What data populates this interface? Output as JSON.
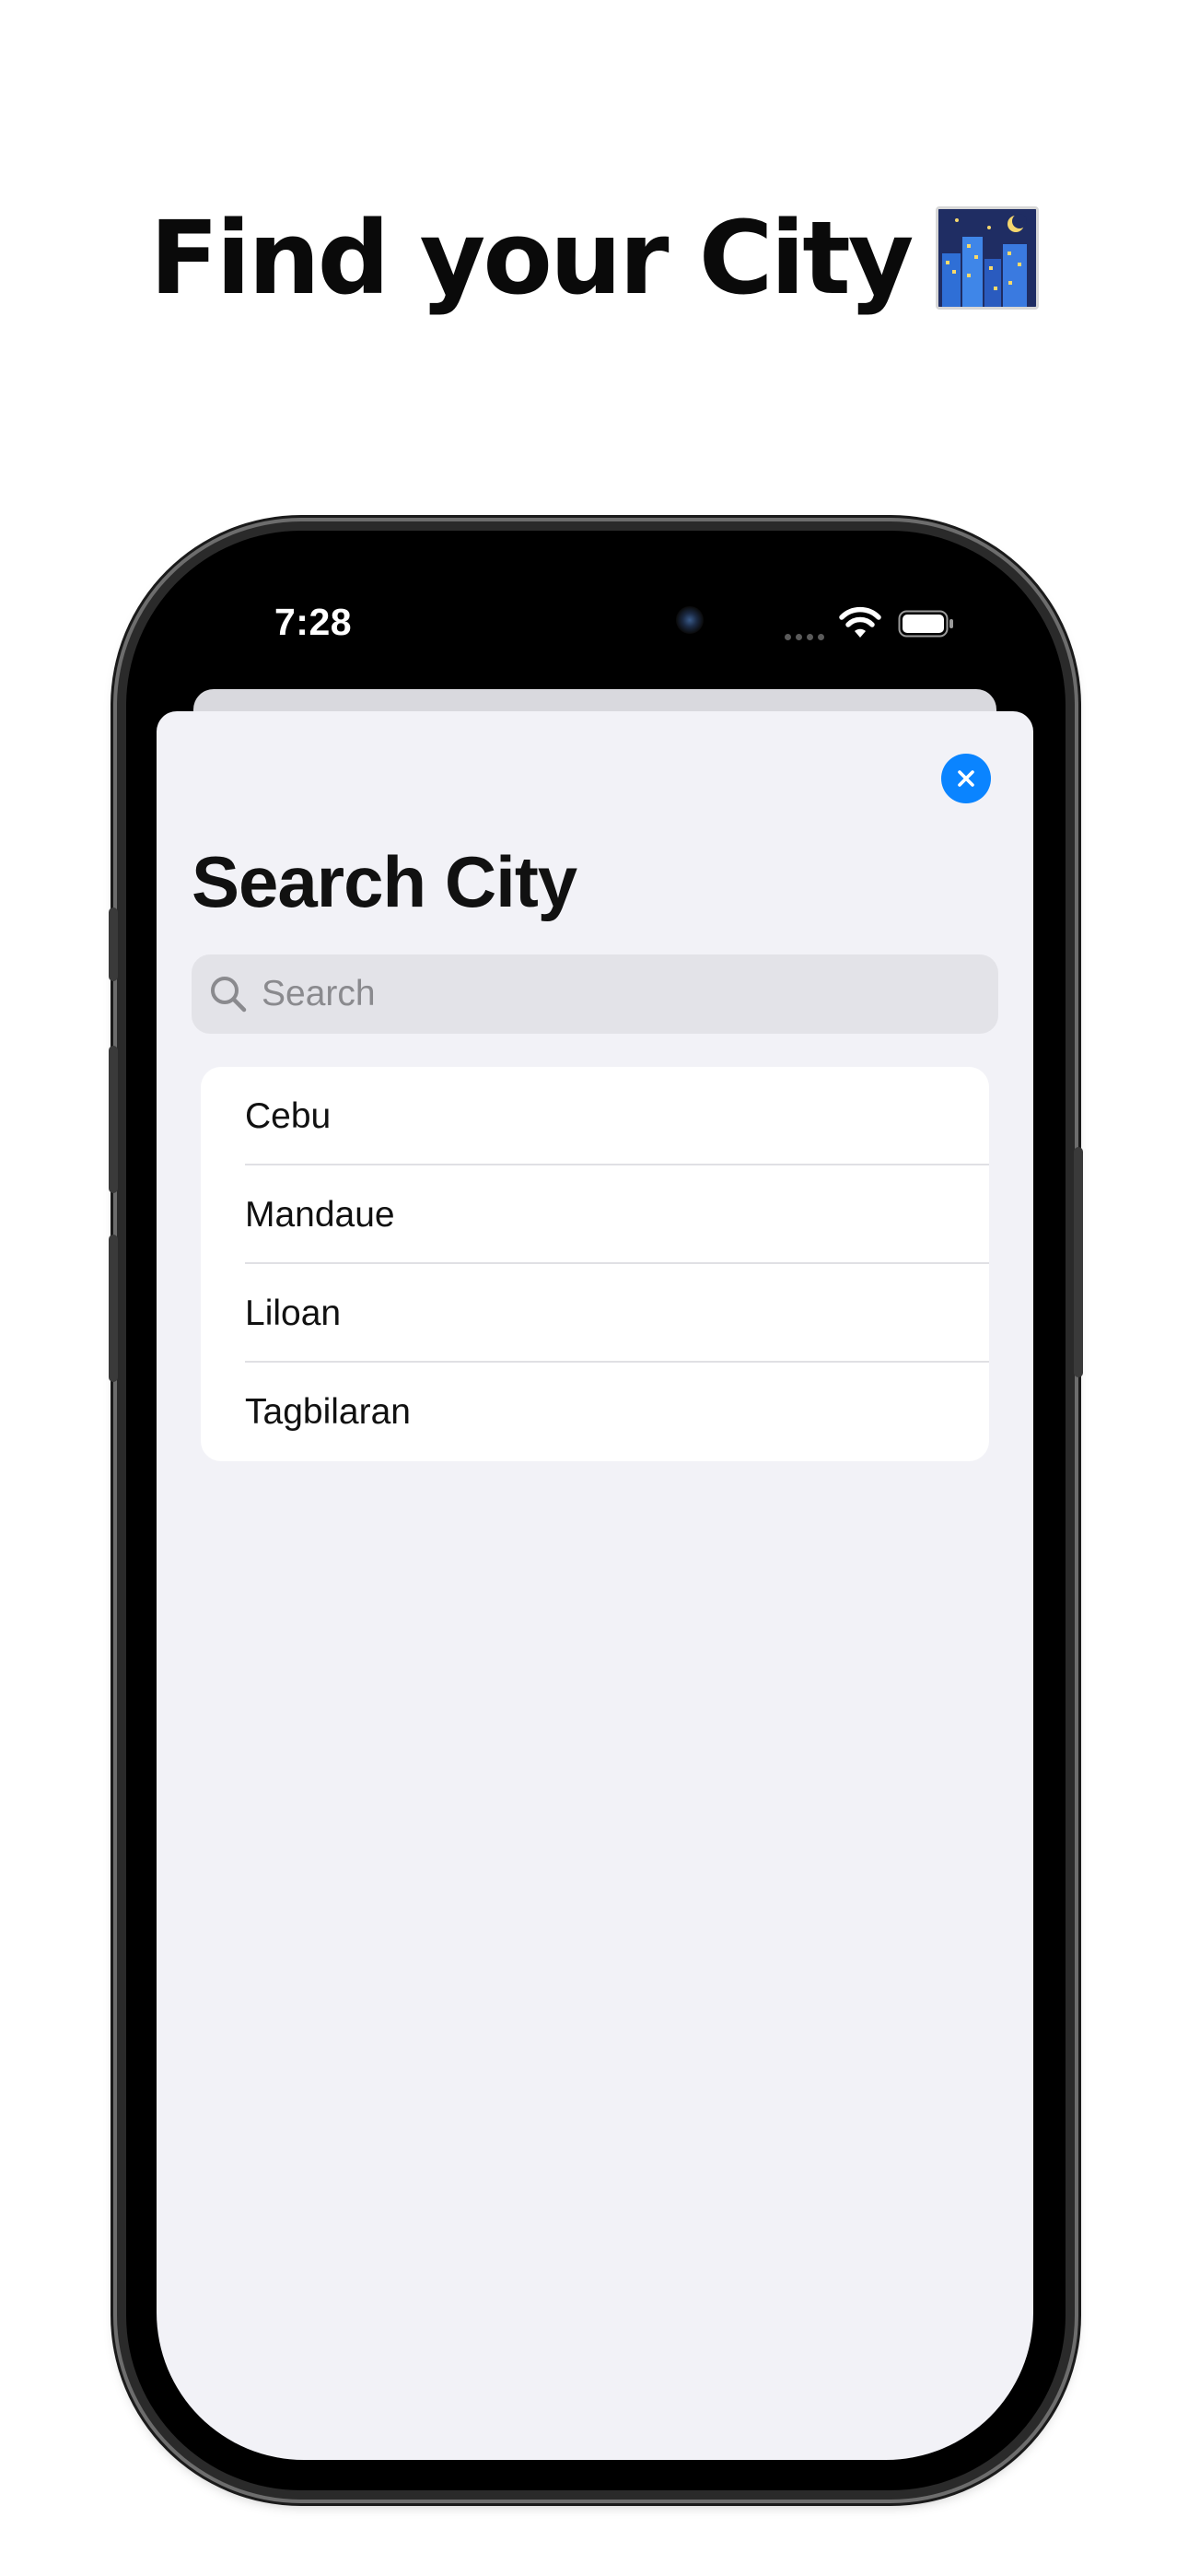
{
  "headline": {
    "text": "Find your City",
    "emoji_icon": "night-city-emoji"
  },
  "status_bar": {
    "time": "7:28",
    "icons": [
      "front-camera",
      "signal-dots-icon",
      "wifi-icon",
      "battery-icon"
    ]
  },
  "sheet": {
    "close_icon": "close-icon",
    "accent_color": "#0a84ff",
    "title": "Search City",
    "search": {
      "placeholder": "Search",
      "value": "",
      "icon": "search-icon"
    },
    "cities": [
      {
        "label": "Cebu"
      },
      {
        "label": "Mandaue"
      },
      {
        "label": "Liloan"
      },
      {
        "label": "Tagbilaran"
      }
    ]
  },
  "colors": {
    "sheet_background": "#f2f2f7",
    "list_background": "#ffffff",
    "search_background": "#e3e3e8"
  }
}
